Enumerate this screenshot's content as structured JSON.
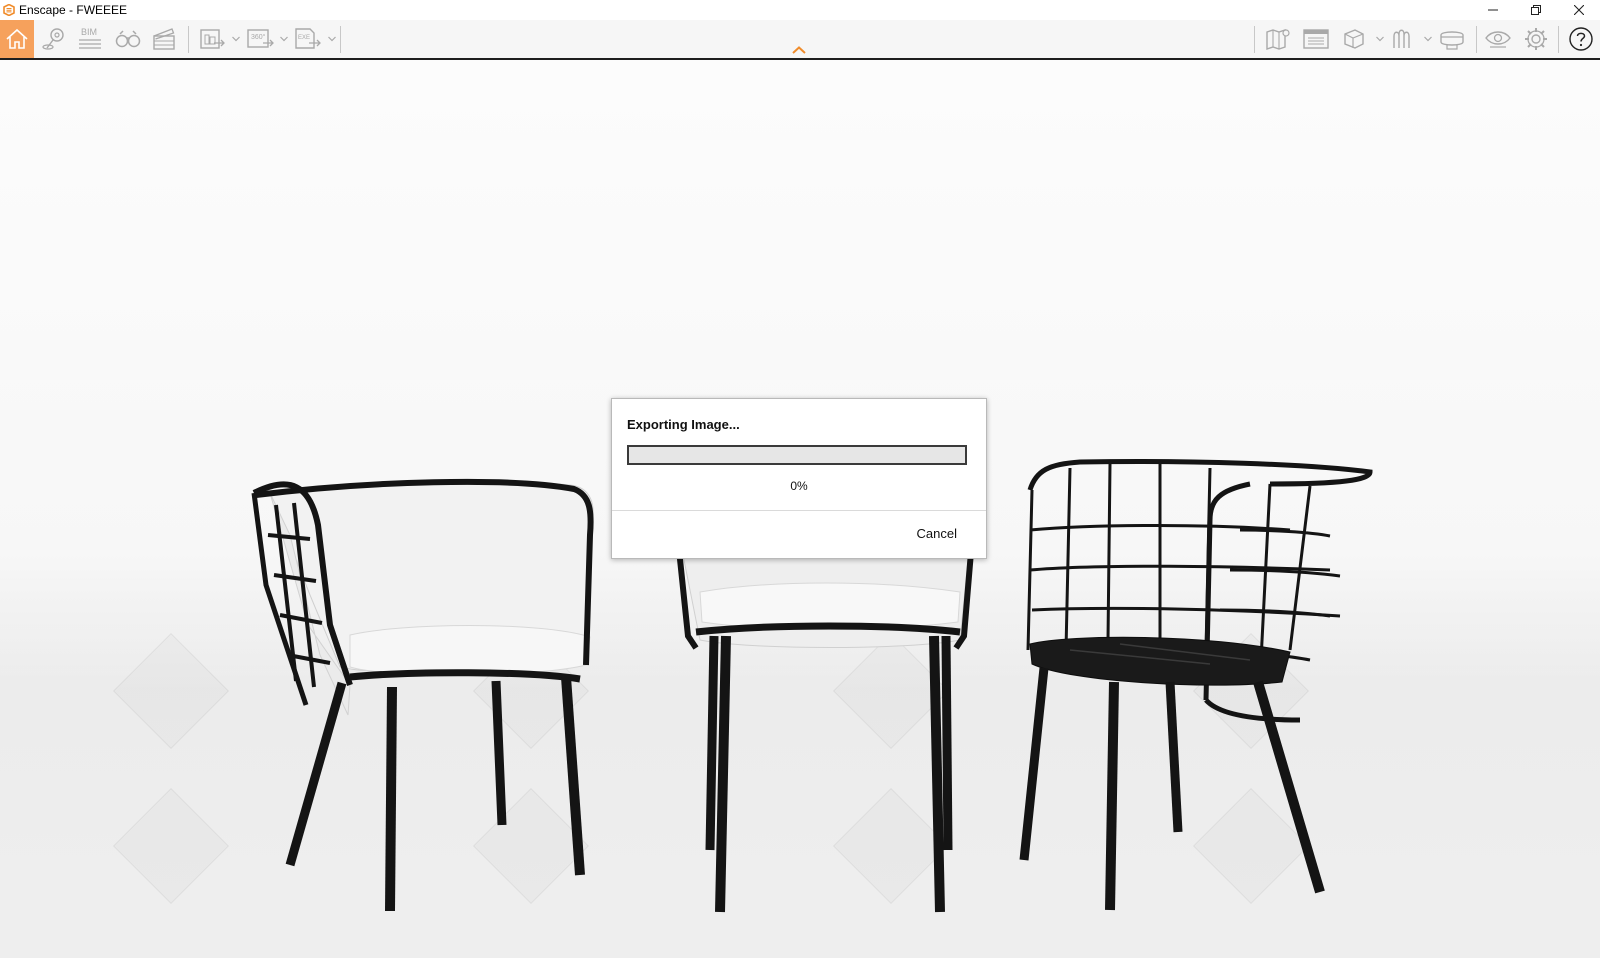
{
  "window": {
    "title": "Enscape - FWEEEE"
  },
  "colors": {
    "accent": "#f08c2b",
    "home_bg": "#f6a15c",
    "toolbar_bg": "#f6f6f6",
    "toolbar_border": "#1e1e1e"
  },
  "toolbar": {
    "left_icons": [
      "home-icon",
      "location-pin-icon",
      "bim-icon",
      "binoculars-icon",
      "clapperboard-icon",
      "screenshot-export-icon",
      "panorama-360-export-icon",
      "exe-export-icon"
    ],
    "bim_label": "BIM",
    "panorama_label": "360°",
    "exe_label": "EXE",
    "right_icons": [
      "map-icon",
      "render-window-icon",
      "cube-view-icon",
      "material-icon",
      "vr-headset-icon",
      "eye-icon",
      "settings-icon",
      "help-icon"
    ]
  },
  "dialog": {
    "title": "Exporting Image...",
    "progress_percent": 0,
    "progress_label": "0%",
    "cancel_label": "Cancel"
  }
}
